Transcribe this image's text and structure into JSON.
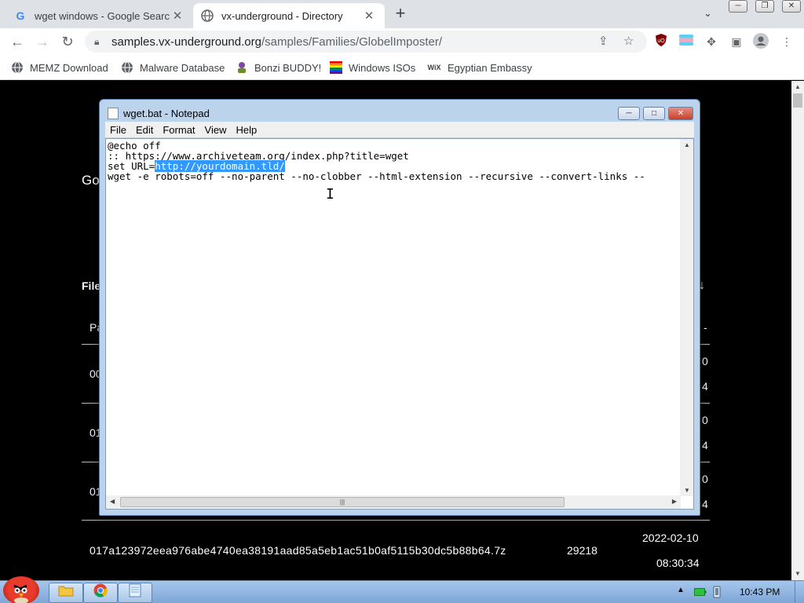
{
  "browser": {
    "tabs": [
      {
        "title": "wget windows - Google Search",
        "favicon": "google-g-icon",
        "active": false
      },
      {
        "title": "vx-underground - Directory",
        "favicon": "globe-icon",
        "active": true
      }
    ],
    "new_tab": "+",
    "url": {
      "host": "samples.vx-underground.org",
      "path": "/samples/Families/GlobelImposter/"
    },
    "bookmarks": [
      {
        "label": "MEMZ Download",
        "icon": "globe-icon"
      },
      {
        "label": "Malware Database",
        "icon": "globe-icon"
      },
      {
        "label": "Bonzi BUDDY!",
        "icon": "bonzi-icon"
      },
      {
        "label": "Windows ISOs",
        "icon": "windows-flag-icon"
      },
      {
        "label": "Egyptian Embassy",
        "icon": "wix-icon"
      }
    ]
  },
  "page": {
    "title_fragment": "Go",
    "files_fragment": "File",
    "sort_arrow": "↓",
    "header_fragment": "Pa",
    "header_dash": "-",
    "row_prefixes": [
      "00",
      "01",
      "01"
    ],
    "right_digits": [
      "0",
      "4",
      "0",
      "4",
      "0",
      "4"
    ],
    "last_row": {
      "filename": "017a123972eea976abe4740ea38191aad85a5eb1ac51b0af5115b30dc5b88b64.7z",
      "size": "29218",
      "date": "2022-02-10",
      "time": "08:30:34"
    }
  },
  "notepad": {
    "title": "wget.bat - Notepad",
    "menu": [
      "File",
      "Edit",
      "Format",
      "View",
      "Help"
    ],
    "lines": {
      "l1": "@echo off",
      "l2": ":: https://www.archiveteam.org/index.php?title=wget",
      "l3_prefix": "set URL=",
      "l3_selected": "http://yourdomain.tld/",
      "l4": "wget -e robots=off --no-parent --no-clobber --html-extension --recursive --convert-links --"
    }
  },
  "taskbar": {
    "clock": "10:43 PM"
  }
}
